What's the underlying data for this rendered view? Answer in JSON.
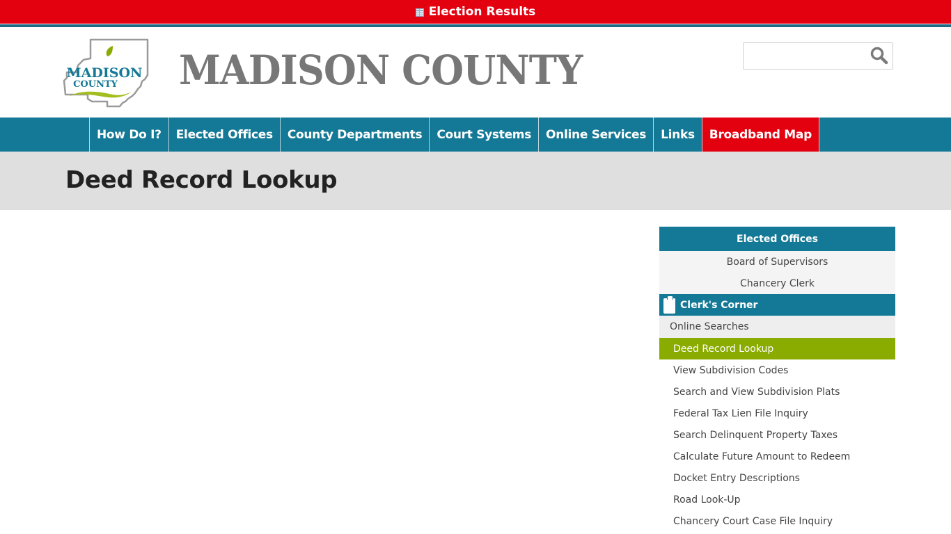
{
  "alert": {
    "icon": "table-icon",
    "label": "Election Results"
  },
  "header": {
    "logo_line1": "MADISON",
    "logo_line2": "COUNTY",
    "site_title": "MADISON COUNTY",
    "search": {
      "placeholder": "",
      "value": "",
      "icon": "search-icon"
    }
  },
  "nav": {
    "items": [
      {
        "label": "How Do I?"
      },
      {
        "label": "Elected Offices"
      },
      {
        "label": "County Departments"
      },
      {
        "label": "Court Systems"
      },
      {
        "label": "Online Services"
      },
      {
        "label": "Links"
      },
      {
        "label": "Broadband Map",
        "highlight": true
      }
    ]
  },
  "page": {
    "title": "Deed Record Lookup"
  },
  "sidebar": {
    "header": "Elected Offices",
    "offices": [
      "Board of Supervisors",
      "Chancery Clerk"
    ],
    "subheader": "Clerk's Corner",
    "subheader_icon": "clipboard-icon",
    "group": "Online Searches",
    "links": [
      {
        "label": "Deed Record Lookup",
        "active": true
      },
      {
        "label": "View Subdivision Codes"
      },
      {
        "label": "Search and View Subdivision Plats"
      },
      {
        "label": "Federal Tax Lien File Inquiry"
      },
      {
        "label": "Search Delinquent Property Taxes"
      },
      {
        "label": "Calculate Future Amount to Redeem"
      },
      {
        "label": "Docket Entry Descriptions"
      },
      {
        "label": "Road Look-Up"
      },
      {
        "label": "Chancery Court Case File Inquiry"
      }
    ]
  },
  "colors": {
    "alert_red": "#e3000f",
    "nav_teal": "#147996",
    "active_green": "#8aab00",
    "title_gray": "#777777",
    "band_gray": "#dfdfdf"
  }
}
